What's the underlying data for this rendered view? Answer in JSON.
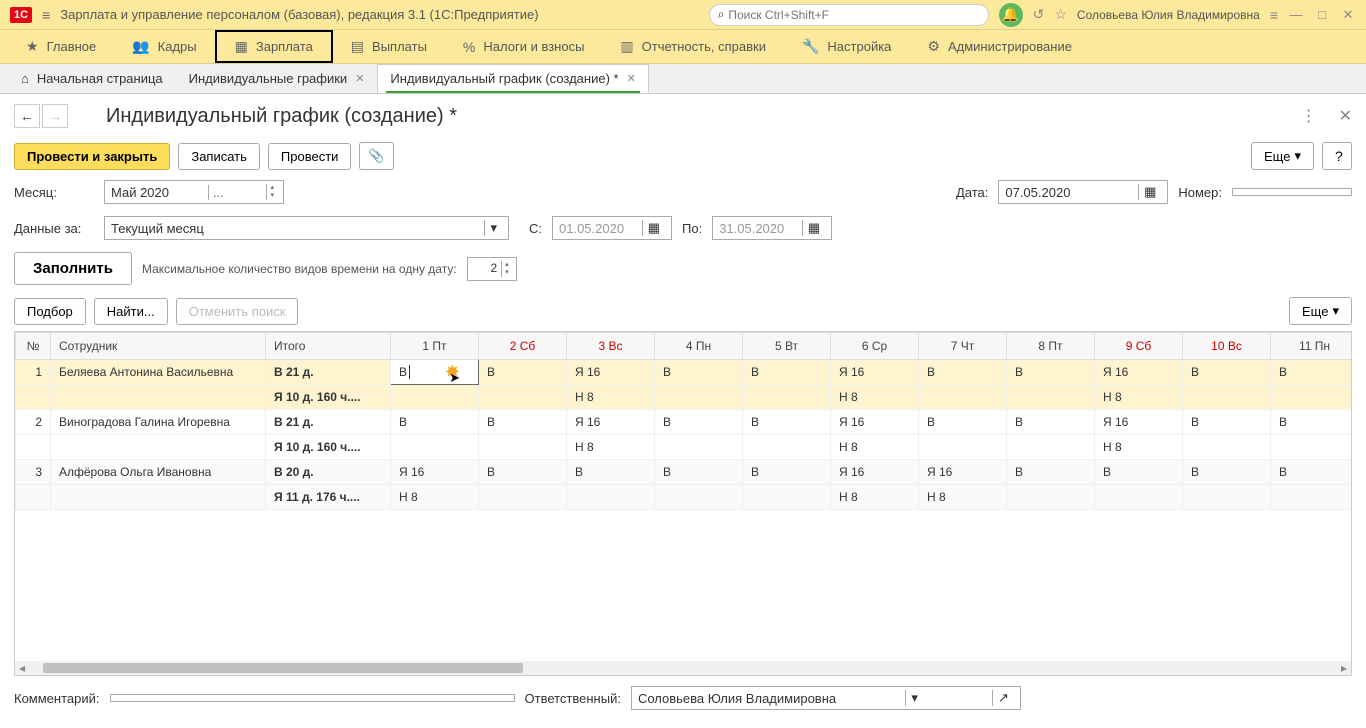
{
  "app": {
    "title": "Зарплата и управление персоналом (базовая), редакция 3.1  (1С:Предприятие)",
    "search_placeholder": "Поиск Ctrl+Shift+F",
    "user": "Соловьева Юлия Владимировна"
  },
  "nav": {
    "main": "Главное",
    "kadry": "Кадры",
    "zarplata": "Зарплата",
    "vyplaty": "Выплаты",
    "nalogi": "Налоги и взносы",
    "otchetnost": "Отчетность, справки",
    "nastroika": "Настройка",
    "admin": "Администрирование"
  },
  "tabs": {
    "start": "Начальная страница",
    "graphics": "Индивидуальные графики",
    "create": "Индивидуальный график (создание) *"
  },
  "page": {
    "title": "Индивидуальный график (создание) *",
    "post_close": "Провести и закрыть",
    "write": "Записать",
    "post": "Провести",
    "more": "Еще",
    "month_label": "Месяц:",
    "month_value": "Май 2020",
    "date_label": "Дата:",
    "date_value": "07.05.2020",
    "number_label": "Номер:",
    "number_value": "",
    "data_for_label": "Данные за:",
    "data_for_value": "Текущий месяц",
    "s_label": "С:",
    "s_value": "01.05.2020",
    "po_label": "По:",
    "po_value": "31.05.2020",
    "fill": "Заполнить",
    "max_label": "Максимальное количество видов времени на одну дату:",
    "max_value": "2",
    "podbor": "Подбор",
    "find": "Найти...",
    "cancel_search": "Отменить поиск",
    "comment_label": "Комментарий:",
    "comment_value": "",
    "responsible_label": "Ответственный:",
    "responsible_value": "Соловьева Юлия Владимировна"
  },
  "table": {
    "headers": {
      "num": "№",
      "employee": "Сотрудник",
      "total": "Итого",
      "d1": "1 Пт",
      "d2": "2 Сб",
      "d3": "3 Вс",
      "d4": "4 Пн",
      "d5": "5 Вт",
      "d6": "6 Ср",
      "d7": "7 Чт",
      "d8": "8 Пт",
      "d9": "9 Сб",
      "d10": "10 Вс",
      "d11": "11 Пн"
    },
    "rows": [
      {
        "n": "1",
        "emp": "Беляева Антонина Васильевна",
        "total": "В 21 д.",
        "d": [
          "В",
          "В",
          "Я 16",
          "В",
          "В",
          "Я 16",
          "В",
          "В",
          "Я 16",
          "В",
          "В"
        ]
      },
      {
        "n": "",
        "emp": "",
        "total": "Я 10 д. 160 ч....",
        "d": [
          "",
          "",
          "Н 8",
          "",
          "",
          "Н 8",
          "",
          "",
          "Н 8",
          "",
          ""
        ]
      },
      {
        "n": "2",
        "emp": "Виноградова Галина Игоревна",
        "total": "В 21 д.",
        "d": [
          "В",
          "В",
          "Я 16",
          "В",
          "В",
          "Я 16",
          "В",
          "В",
          "Я 16",
          "В",
          "В"
        ]
      },
      {
        "n": "",
        "emp": "",
        "total": "Я 10 д. 160 ч....",
        "d": [
          "",
          "",
          "Н 8",
          "",
          "",
          "Н 8",
          "",
          "",
          "Н 8",
          "",
          ""
        ]
      },
      {
        "n": "3",
        "emp": "Алфёрова Ольга Ивановна",
        "total": "В 20 д.",
        "d": [
          "Я 16",
          "В",
          "В",
          "В",
          "В",
          "Я 16",
          "Я 16",
          "В",
          "В",
          "В",
          "В"
        ]
      },
      {
        "n": "",
        "emp": "",
        "total": "Я 11 д. 176 ч....",
        "d": [
          "Н 8",
          "",
          "",
          "",
          "",
          "Н 8",
          "Н 8",
          "",
          "",
          "",
          ""
        ]
      }
    ]
  }
}
